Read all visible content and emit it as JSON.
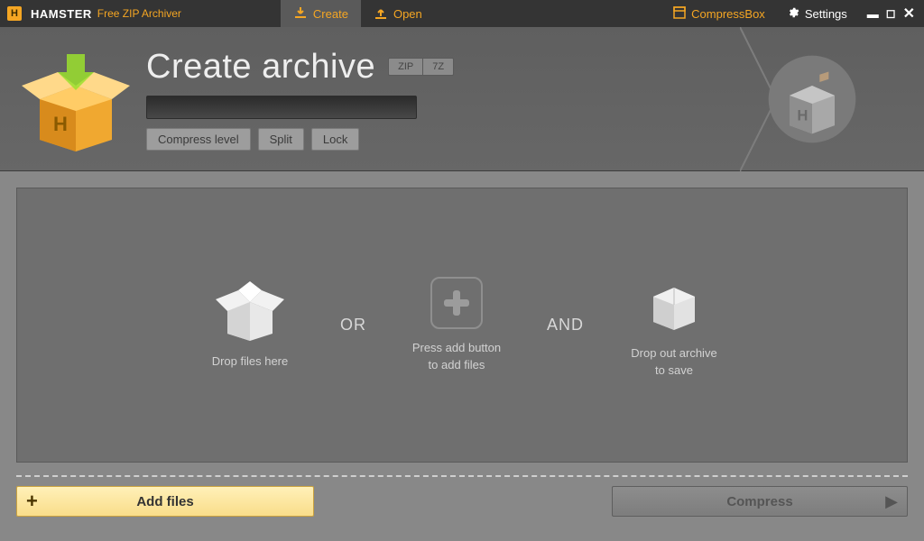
{
  "app": {
    "brand_main": "HAMSTER",
    "brand_sub": "Free ZIP Archiver"
  },
  "topbar": {
    "create": "Create",
    "open": "Open",
    "compressbox": "CompressBox",
    "settings": "Settings"
  },
  "header": {
    "title": "Create archive",
    "format_zip": "ZIP",
    "format_7z": "7Z",
    "options": {
      "compress_level": "Compress level",
      "split": "Split",
      "lock": "Lock"
    }
  },
  "dropzone": {
    "drop_here": "Drop files here",
    "or": "OR",
    "add_button": "Press add button\nto add files",
    "and": "AND",
    "drop_out": "Drop out archive\nto save"
  },
  "bottom": {
    "add_files": "Add files",
    "compress": "Compress"
  }
}
